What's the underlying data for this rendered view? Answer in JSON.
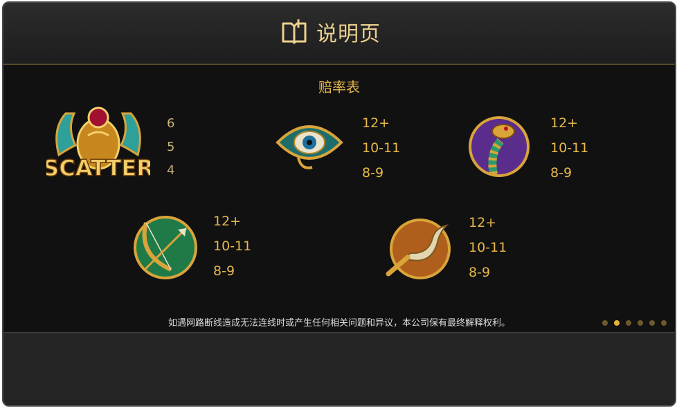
{
  "header": {
    "title": "说明页",
    "icon": "book-icon"
  },
  "paytable": {
    "title": "赔率表",
    "symbols": [
      {
        "name": "scatter",
        "label": "SCATTER",
        "pays": [
          "6",
          "5",
          "4"
        ]
      },
      {
        "name": "eye-of-horus",
        "pays": [
          "12+",
          "10-11",
          "8-9"
        ]
      },
      {
        "name": "cobra",
        "pays": [
          "12+",
          "10-11",
          "8-9"
        ]
      },
      {
        "name": "bow-arrow",
        "pays": [
          "12+",
          "10-11",
          "8-9"
        ]
      },
      {
        "name": "khopesh",
        "pays": [
          "12+",
          "10-11",
          "8-9"
        ]
      }
    ]
  },
  "disclaimer": "如遇网路断线造成无法连线时或产生任何相关问题和异议，本公司保有最终解释权利。",
  "pagination": {
    "total": 6,
    "active": 1
  },
  "colors": {
    "gold": "#e8b84a",
    "title": "#ecd08e",
    "background": "#111111"
  }
}
